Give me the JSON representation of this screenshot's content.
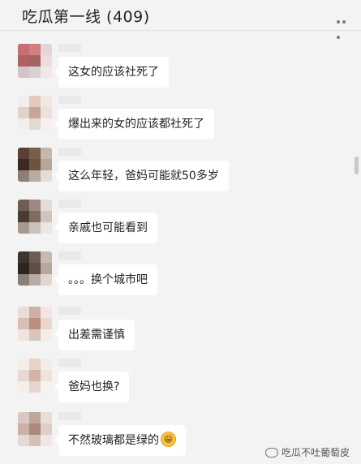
{
  "header": {
    "title": "吃瓜第一线 (409)"
  },
  "messages": [
    {
      "text": "这女的应该社死了",
      "avatar_colors": [
        "#c47070",
        "#d47d7d",
        "#e6d3d3",
        "#b06060",
        "#a56262",
        "#eddede",
        "#d2c5c5",
        "#d9d0d0",
        "#f0e7e7"
      ]
    },
    {
      "text": "爆出来的女的应该都社死了",
      "avatar_colors": [
        "#f2eded",
        "#e4c9c0",
        "#f1e6e1",
        "#e3d1c9",
        "#c8a594",
        "#ece1dc",
        "#f2eeec",
        "#e4d8d3",
        "#f5f1ef"
      ]
    },
    {
      "text": "这么年轻，爸妈可能就50多岁",
      "avatar_colors": [
        "#5a4034",
        "#7a5d4d",
        "#c6b6ab",
        "#3a2a22",
        "#6b5444",
        "#b7a597",
        "#8f7e72",
        "#b9ab9f",
        "#e4ddd6"
      ]
    },
    {
      "text": "亲戚也可能看到",
      "avatar_colors": [
        "#6f5e54",
        "#9a8a80",
        "#e2dbd6",
        "#4a3c34",
        "#7d6c62",
        "#cfc5be",
        "#a69990",
        "#cbc1b9",
        "#ece6e2"
      ]
    },
    {
      "text": "。。。换个城市吧",
      "avatar_colors": [
        "#3c342f",
        "#6c5d54",
        "#c5b9b1",
        "#2d2520",
        "#5d4f46",
        "#b3a79f",
        "#8c7f77",
        "#b8aca4",
        "#ded6d0"
      ]
    },
    {
      "text": "出差需谨慎",
      "avatar_colors": [
        "#eadcd6",
        "#cdb0a4",
        "#f1e6e2",
        "#d8c0b5",
        "#b98e7c",
        "#e8d7cf",
        "#efe3de",
        "#d9c5bc",
        "#f4ece8"
      ]
    },
    {
      "text": "爸妈也换?",
      "avatar_colors": [
        "#f4eeea",
        "#e7d2c9",
        "#f3ece8",
        "#ead7cf",
        "#d3b3a5",
        "#efe3dd",
        "#f5efec",
        "#e6d6cf",
        "#f7f2ef"
      ]
    },
    {
      "text": "不然玻璃都是绿的",
      "avatar_colors": [
        "#d8c8c1",
        "#bfa69b",
        "#e8ddd8",
        "#c9b1a6",
        "#a98a7c",
        "#ddcfc8",
        "#e4d9d4",
        "#d2c1b9",
        "#efe7e3"
      ],
      "emoji": "😁"
    }
  ],
  "watermark": {
    "text": "吃瓜不吐葡萄皮"
  }
}
